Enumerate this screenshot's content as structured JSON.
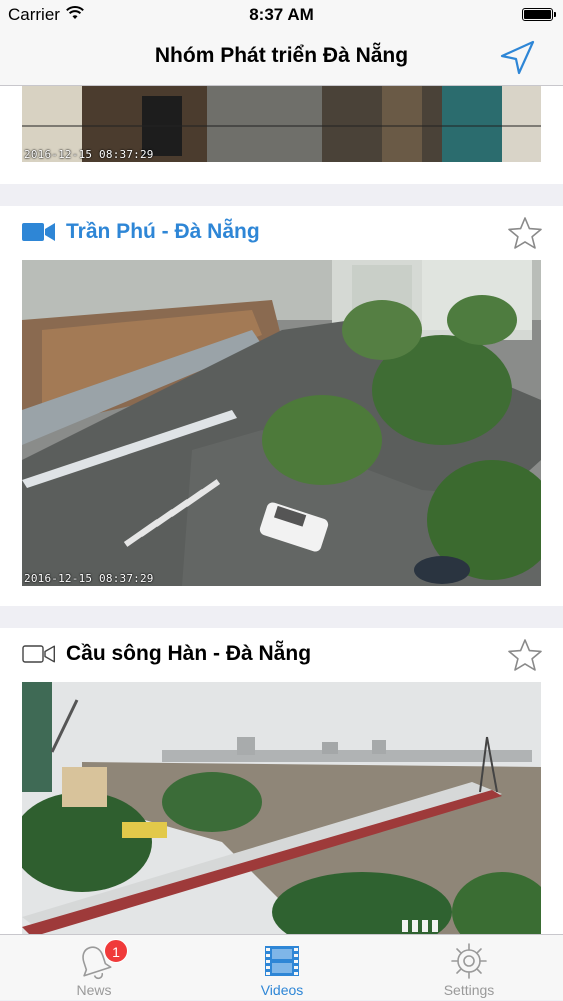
{
  "status_bar": {
    "carrier": "Carrier",
    "time": "8:37 AM"
  },
  "nav": {
    "title": "Nhóm Phát triển Đà Nẵng",
    "location_icon": "location-arrow-icon"
  },
  "cameras": [
    {
      "title": "",
      "timestamp": "2016-12-15 08:37:29",
      "favorite": false
    },
    {
      "title": "Trần Phú - Đà Nẵng",
      "timestamp": "2016-12-15 08:37:29",
      "active": true,
      "favorite": false
    },
    {
      "title": "Cầu sông Hàn - Đà Nẵng",
      "active": false,
      "favorite": false
    }
  ],
  "tabs": [
    {
      "label": "News",
      "icon": "bell-icon",
      "badge": "1"
    },
    {
      "label": "Videos",
      "icon": "film-icon",
      "active": true
    },
    {
      "label": "Settings",
      "icon": "gear-icon"
    }
  ],
  "colors": {
    "accent": "#2e86d6",
    "badge": "#f03a3a",
    "inactive": "#9a9a9a"
  }
}
